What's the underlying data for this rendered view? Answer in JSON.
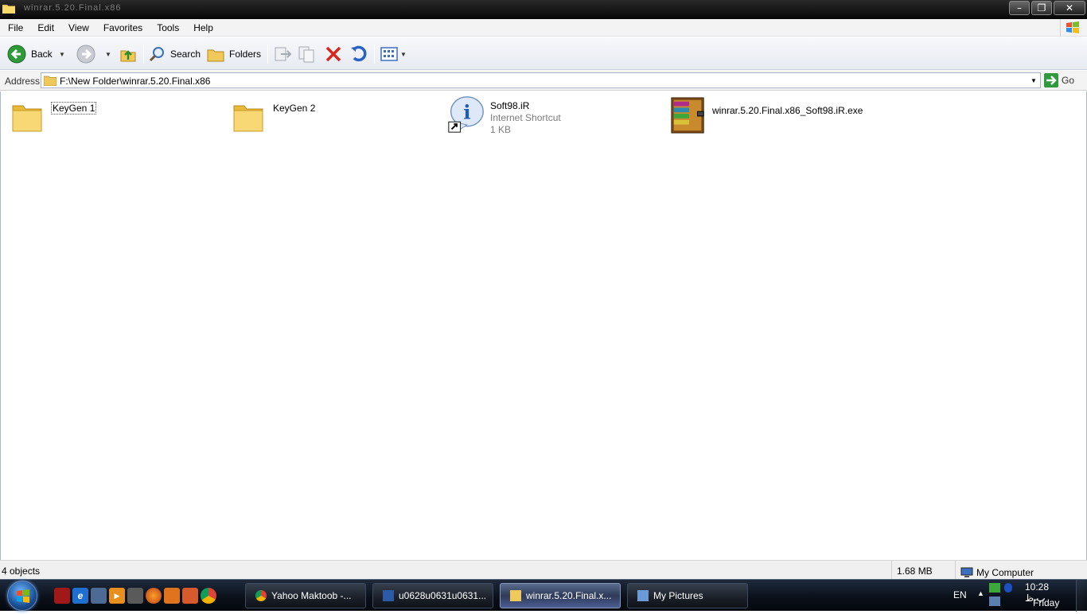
{
  "window": {
    "title": "winrar.5.20.Final.x86"
  },
  "menu": [
    "File",
    "Edit",
    "View",
    "Favorites",
    "Tools",
    "Help"
  ],
  "toolbar": {
    "back_label": "Back",
    "search_label": "Search",
    "folders_label": "Folders"
  },
  "address": {
    "label": "Address",
    "path": "F:\\New Folder\\winrar.5.20.Final.x86",
    "go_label": "Go"
  },
  "files": [
    {
      "name": "KeyGen 1",
      "icon": "folder-icon"
    },
    {
      "name": "KeyGen 2",
      "icon": "folder-icon"
    },
    {
      "name": "Soft98.iR",
      "type": "Internet Shortcut",
      "size": "1 KB",
      "icon": "internet-shortcut-icon"
    },
    {
      "name": "winrar.5.20.Final.x86_Soft98.iR.exe",
      "icon": "winrar-archive-icon"
    }
  ],
  "status": {
    "objects": "4 objects",
    "size": "1.68 MB",
    "location": "My Computer"
  },
  "taskbar": {
    "tasks": [
      {
        "label": "Yahoo Maktoob -..."
      },
      {
        "label": "u0628u0631u0631..."
      },
      {
        "label": "winrar.5.20.Final.x..."
      },
      {
        "label": "My Pictures"
      }
    ],
    "lang": "EN",
    "time": "10:28 ب.ظ",
    "day": "Friday"
  },
  "colors": {
    "accent": "#1e5bb8",
    "taskbar": "#0a0f18",
    "toolbar": "#e7ebf2"
  }
}
